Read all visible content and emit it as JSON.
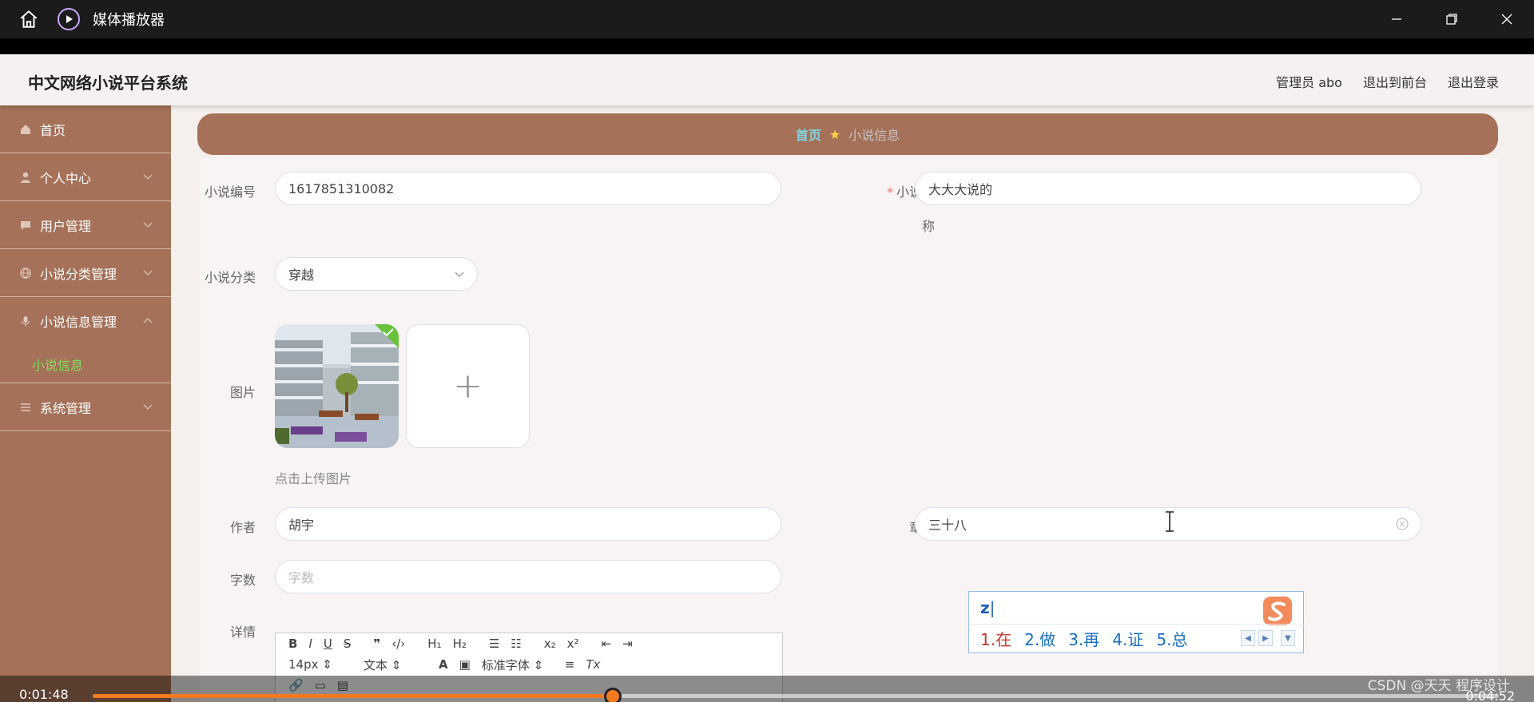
{
  "player": {
    "title": "媒体播放器",
    "current_time": "0:01:48",
    "total_time": "0:04:52",
    "progress": 0.37,
    "watermark": "CSDN @天天 程序设计",
    "accent": "#f47a20"
  },
  "app": {
    "brand": "中文网络小说平台系统",
    "header_links": [
      "管理员 abo",
      "退出到前台",
      "退出登录"
    ],
    "sidebar_color": "#a57158"
  },
  "sidebar": {
    "items": [
      {
        "label": "首页",
        "icon": "home-icon"
      },
      {
        "label": "个人中心",
        "icon": "user-icon"
      },
      {
        "label": "用户管理",
        "icon": "message-icon"
      },
      {
        "label": "小说分类管理",
        "icon": "globe-icon"
      },
      {
        "label": "小说信息管理",
        "icon": "mic-icon"
      },
      {
        "label": "系统管理",
        "icon": "menu-icon"
      }
    ],
    "sub_active": "小说信息"
  },
  "breadcrumb": {
    "home": "首页",
    "current": "小说信息"
  },
  "form": {
    "novel_no": {
      "label": "小说编号",
      "value": "1617851310082"
    },
    "novel_name": {
      "label_line1": "小说名",
      "label_line2": "称",
      "value": "大大大说的"
    },
    "category": {
      "label": "小说分类",
      "value": "穿越"
    },
    "image": {
      "label": "图片",
      "hint": "点击上传图片",
      "plus": "+"
    },
    "author": {
      "label": "作者",
      "value": "胡宇"
    },
    "chapter": {
      "label": "章节",
      "value": "三十八"
    },
    "word_count": {
      "label": "字数",
      "placeholder": "字数"
    },
    "detail": {
      "label": "详情",
      "font_size": "14px",
      "block_type": "文本",
      "font_family": "标准字体"
    }
  },
  "ime": {
    "input": "z",
    "candidates": [
      "1.在",
      "2.做",
      "3.再",
      "4.证",
      "5.总"
    ]
  }
}
